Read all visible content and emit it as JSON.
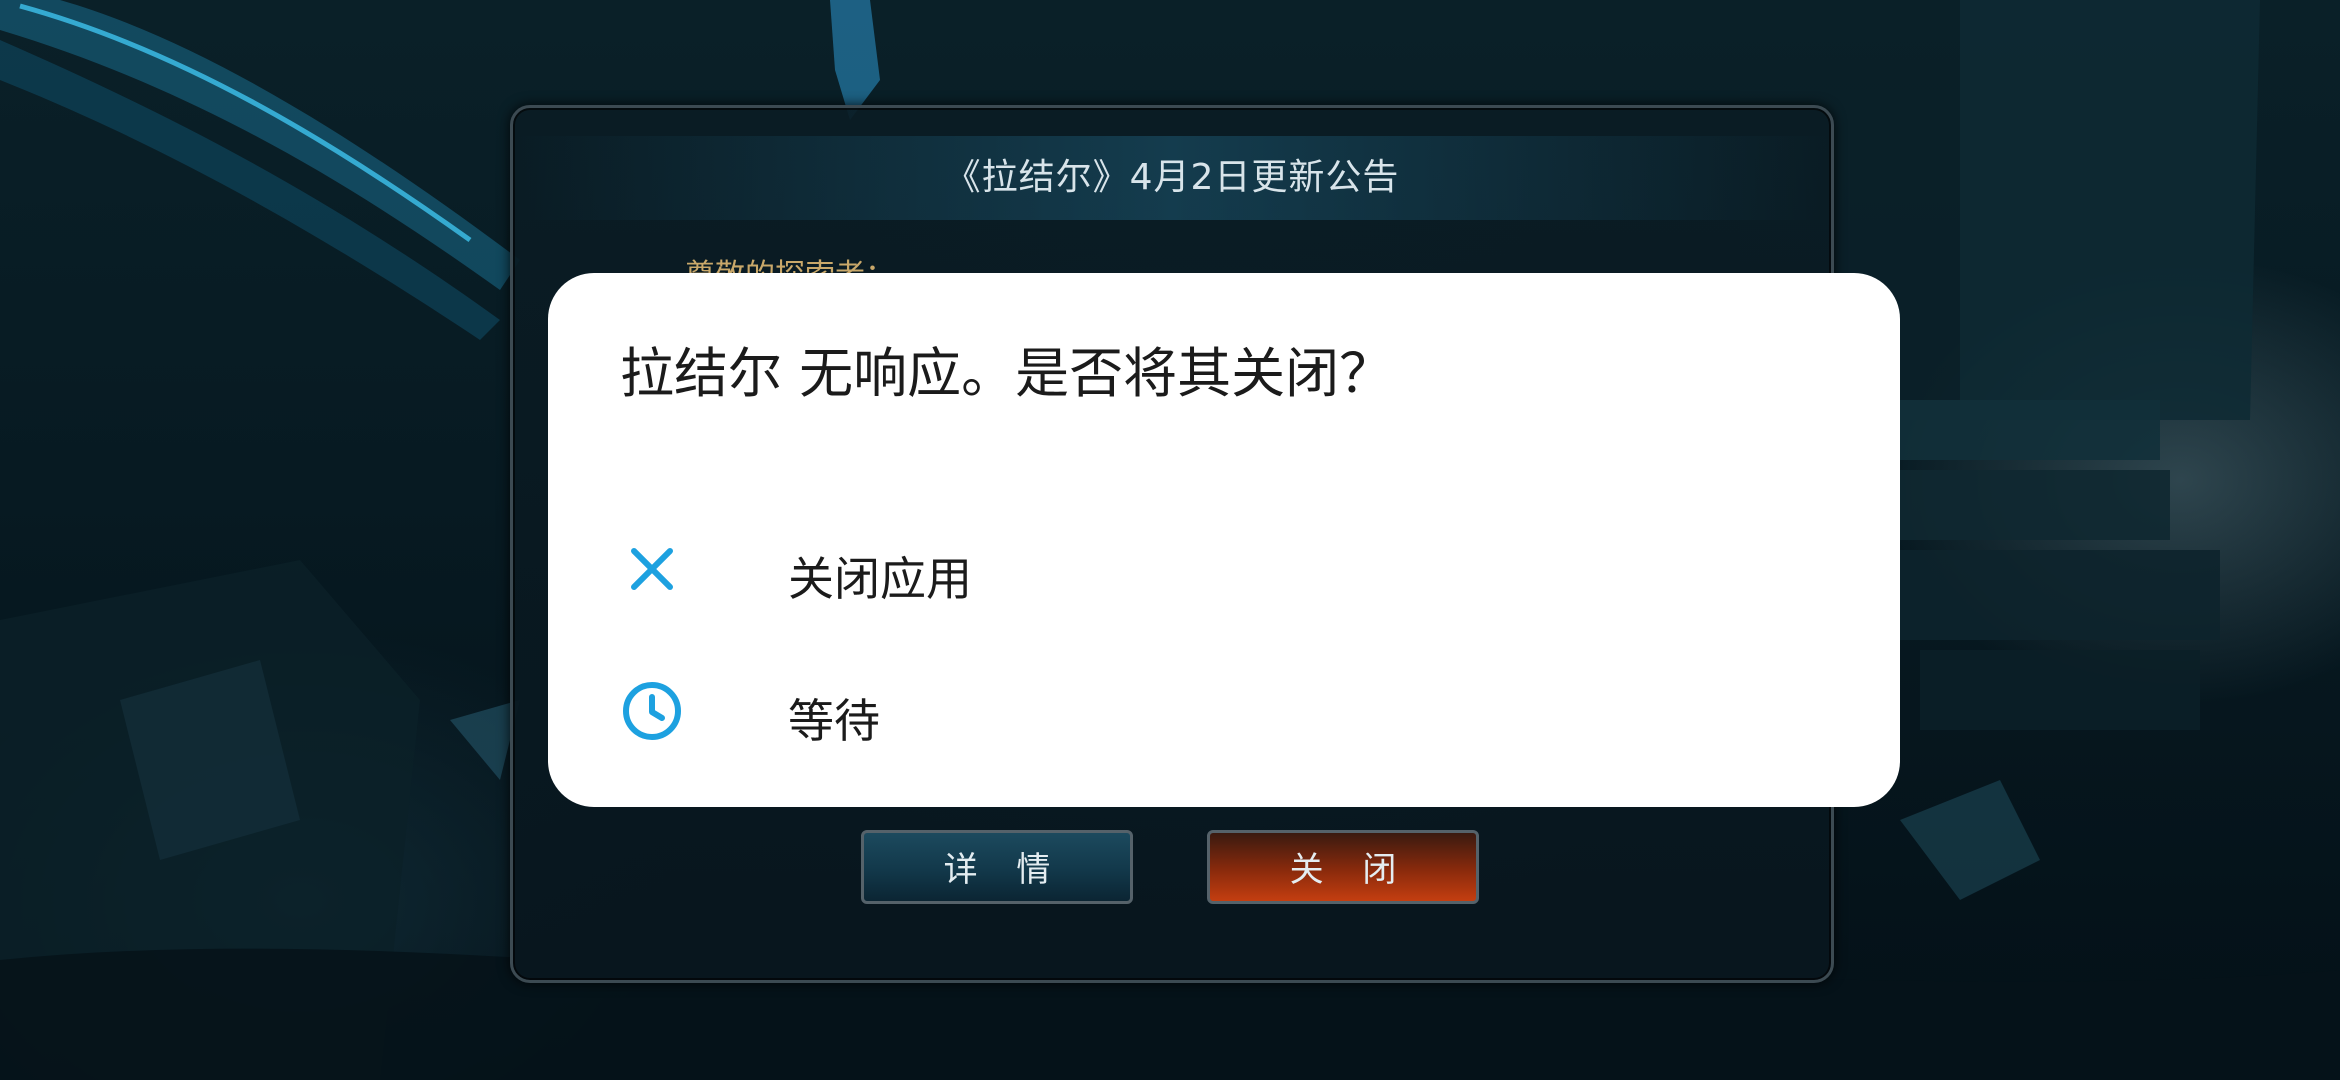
{
  "game_notice": {
    "title": "《拉结尔》4月2日更新公告",
    "greeting": "尊敬的探索者：",
    "detail_button": "详 情",
    "close_button": "关 闭"
  },
  "anr_dialog": {
    "message": "拉结尔 无响应。是否将其关闭？",
    "options": [
      {
        "label": "关闭应用",
        "icon": "close-icon"
      },
      {
        "label": "等待",
        "icon": "clock-icon"
      }
    ],
    "accent_color": "#1da1e0"
  }
}
